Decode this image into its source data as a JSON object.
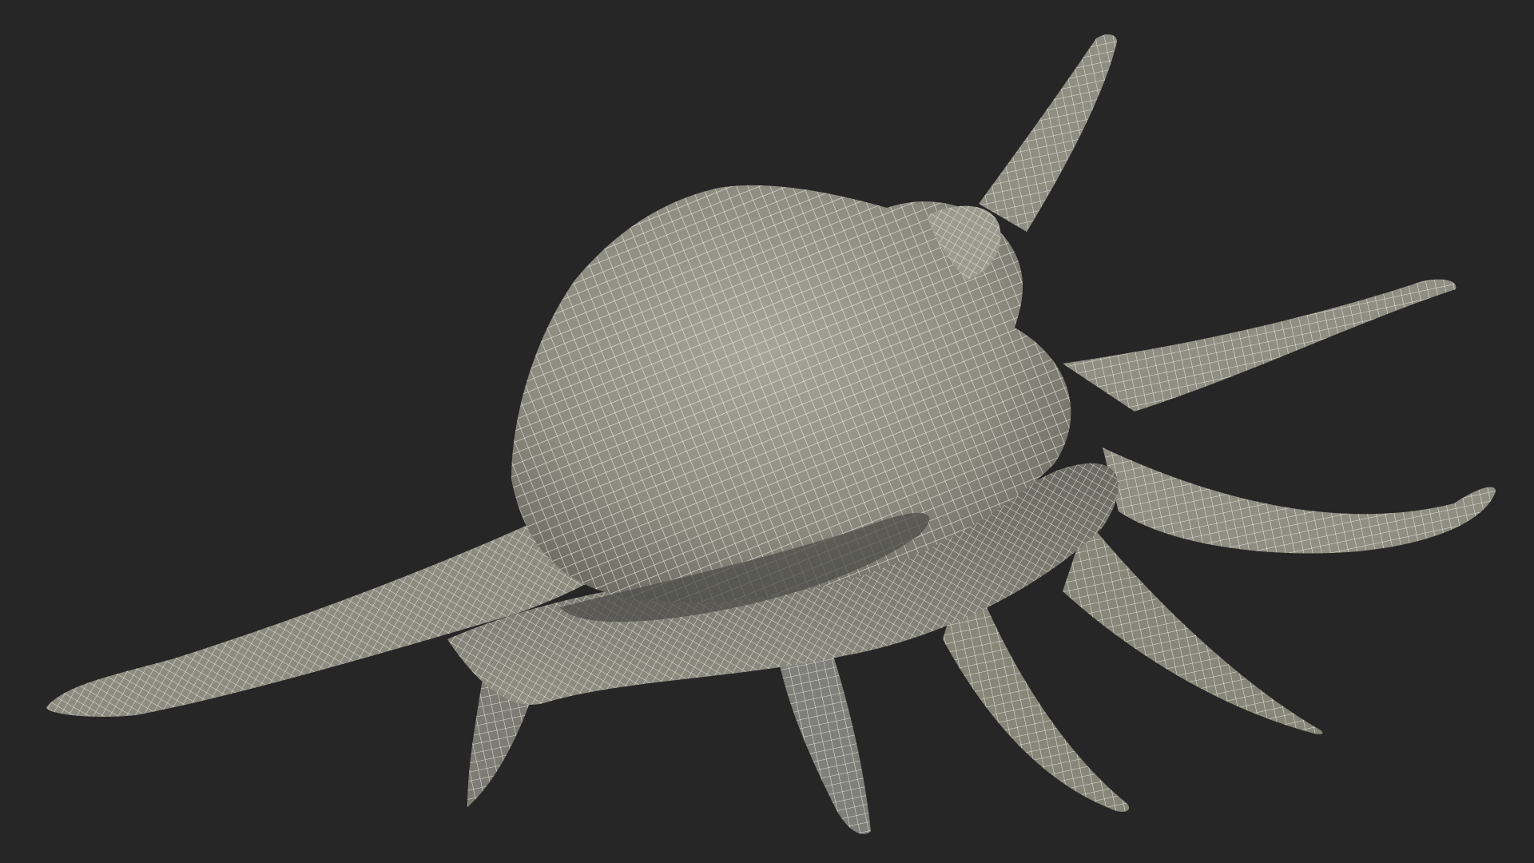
{
  "scene": {
    "subject": "spider-conch-shell-wireframe",
    "render_mode": "wireframe-over-shaded"
  },
  "colors": {
    "background": "#262626",
    "surface": "#8b8b80",
    "surface_light": "#a4a498",
    "surface_shadow": "#5f5f57",
    "wire": "#f2f2e8"
  }
}
